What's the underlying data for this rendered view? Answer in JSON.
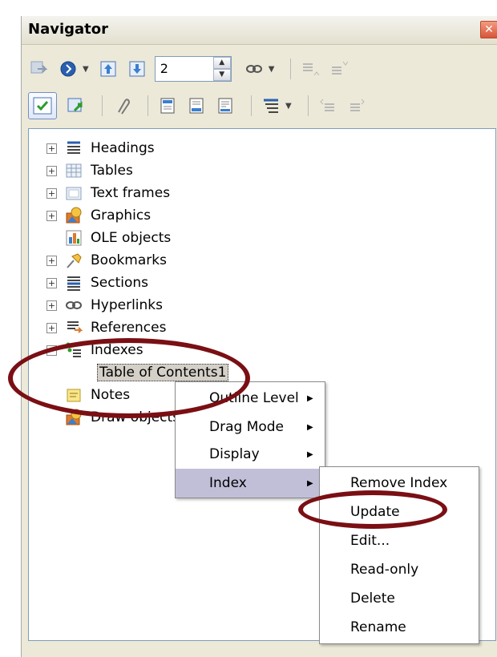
{
  "window": {
    "title": "Navigator",
    "close_label": "✕"
  },
  "toolbar": {
    "spin_value": "2",
    "icons": [
      "navigation-icon",
      "next-icon",
      "promote-chapter-icon",
      "demote-chapter-icon",
      "hyperlink-icon",
      "promote-level-icon",
      "demote-level-icon",
      "list-box-icon",
      "content-view-icon",
      "reminder-icon",
      "header-icon",
      "footer-icon",
      "anchor-endnote-icon",
      "heading-levels-icon",
      "promote-icon",
      "demote-icon"
    ]
  },
  "tree": {
    "items": [
      {
        "label": "Headings",
        "icon": "headings-icon",
        "expandable": true
      },
      {
        "label": "Tables",
        "icon": "tables-icon",
        "expandable": true
      },
      {
        "label": "Text frames",
        "icon": "text-frames-icon",
        "expandable": true
      },
      {
        "label": "Graphics",
        "icon": "graphics-icon",
        "expandable": true
      },
      {
        "label": "OLE objects",
        "icon": "ole-objects-icon",
        "expandable": false
      },
      {
        "label": "Bookmarks",
        "icon": "bookmarks-icon",
        "expandable": true
      },
      {
        "label": "Sections",
        "icon": "sections-icon",
        "expandable": true
      },
      {
        "label": "Hyperlinks",
        "icon": "hyperlinks-icon",
        "expandable": true
      },
      {
        "label": "References",
        "icon": "references-icon",
        "expandable": true
      },
      {
        "label": "Indexes",
        "icon": "indexes-icon",
        "expandable": true,
        "expanded": true
      },
      {
        "label": "Table of Contents1",
        "child": true,
        "selected": true
      },
      {
        "label": "Notes",
        "icon": "notes-icon",
        "expandable": false
      },
      {
        "label": "Draw objects",
        "icon": "draw-objects-icon",
        "expandable": false
      }
    ]
  },
  "context_menu": {
    "items": [
      {
        "label": "Outline Level",
        "submenu": true
      },
      {
        "label": "Drag Mode",
        "submenu": true
      },
      {
        "label": "Display",
        "submenu": true
      },
      {
        "label": "Index",
        "submenu": true,
        "highlighted": true
      }
    ]
  },
  "index_submenu": {
    "items": [
      {
        "label": "Remove Index"
      },
      {
        "label": "Update"
      },
      {
        "label": "Edit..."
      },
      {
        "label": "Read-only"
      },
      {
        "label": "Delete"
      },
      {
        "label": "Rename"
      }
    ]
  },
  "colors": {
    "annotation": "#7a0f14",
    "selection": "#c1bfd8",
    "panel": "#ece9d8"
  }
}
